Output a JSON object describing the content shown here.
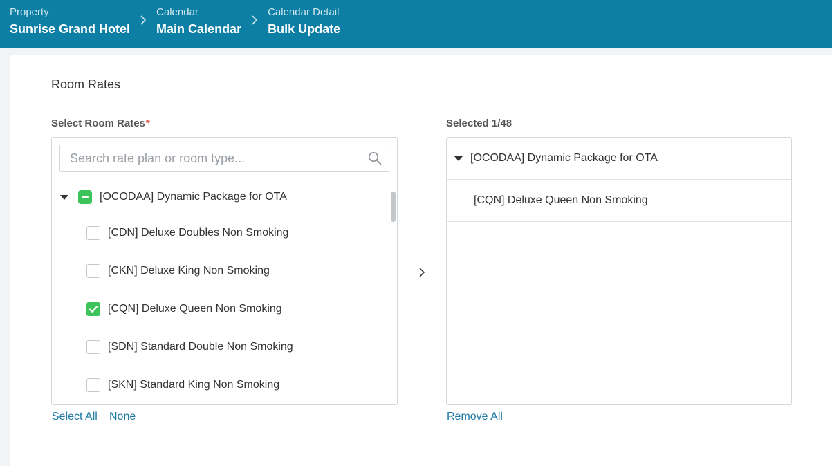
{
  "breadcrumbs": [
    {
      "label": "Property",
      "value": "Sunrise Grand Hotel"
    },
    {
      "label": "Calendar",
      "value": "Main Calendar"
    },
    {
      "label": "Calendar Detail",
      "value": "Bulk Update"
    }
  ],
  "section": {
    "title": "Room Rates"
  },
  "select_panel": {
    "label": "Select Room Rates",
    "required_mark": "*",
    "search_placeholder": "Search rate plan or room type...",
    "group": {
      "label": "[OCODAA] Dynamic Package for OTA",
      "state": "partial"
    },
    "items": [
      {
        "label": "[CDN] Deluxe Doubles Non Smoking",
        "checked": false
      },
      {
        "label": "[CKN] Deluxe King Non Smoking",
        "checked": false
      },
      {
        "label": "[CQN] Deluxe Queen Non Smoking",
        "checked": true
      },
      {
        "label": "[SDN] Standard Double Non Smoking",
        "checked": false
      },
      {
        "label": "[SKN] Standard King Non Smoking",
        "checked": false
      }
    ],
    "select_all": "Select All",
    "separator": "|",
    "none": "None"
  },
  "selected_panel": {
    "label": "Selected 1/48",
    "group": "[OCODAA] Dynamic Package for OTA",
    "items": [
      "[CQN] Deluxe Queen Non Smoking"
    ],
    "remove_all": "Remove All"
  },
  "colors": {
    "header_bg": "#0d7fa5",
    "check_green": "#3cc45a",
    "link_blue": "#1f7aa6",
    "required_red": "#e04a3f"
  },
  "icons": {
    "breadcrumb_separator": "chevron-right-icon",
    "search": "search-icon",
    "expand": "caret-down-icon",
    "move": "chevron-right-icon"
  }
}
